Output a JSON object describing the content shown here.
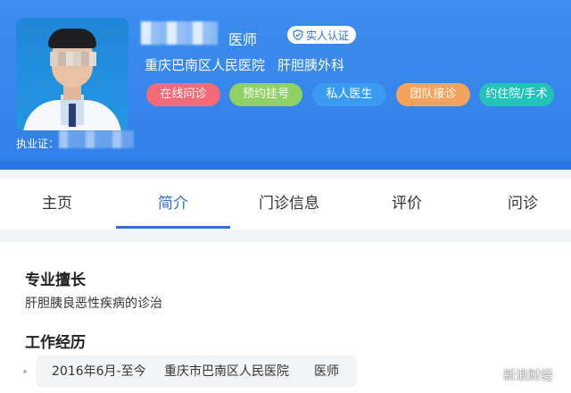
{
  "header": {
    "title": "医师",
    "verify_badge": "实人认证",
    "hospital": "重庆巴南区人民医院",
    "department": "肝胆胰外科",
    "license_label": "执业证：",
    "services": [
      {
        "label": "在线问诊",
        "color": "#f36b77"
      },
      {
        "label": "预约挂号",
        "color": "#8fd162"
      },
      {
        "label": "私人医生",
        "color": "#3a9cf0"
      },
      {
        "label": "团队接诊",
        "color": "#f5a25d"
      },
      {
        "label": "约住院/手术",
        "color": "#22c3b8"
      }
    ]
  },
  "tabs": [
    {
      "label": "主页"
    },
    {
      "label": "简介"
    },
    {
      "label": "门诊信息"
    },
    {
      "label": "评价"
    },
    {
      "label": "问诊"
    }
  ],
  "active_tab": "简介",
  "profile": {
    "specialty_title": "专业擅长",
    "specialty_text": "肝胆胰良恶性疾病的诊治",
    "work_title": "工作经历",
    "work": {
      "period": "2016年6月-至今",
      "hospital": "重庆市巴南区人民医院",
      "title": "医师"
    }
  },
  "watermark": "新浪财经",
  "colors": {
    "accent": "#2f6fd8",
    "header_bg": "#3e8ef0"
  }
}
